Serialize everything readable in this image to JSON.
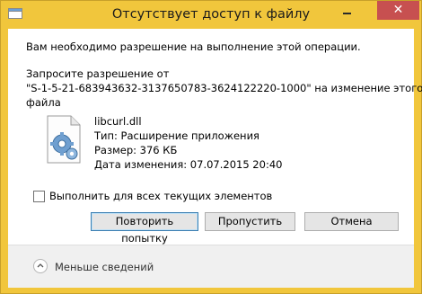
{
  "window": {
    "title": "Отсутствует доступ к файлу",
    "close_label": "✕"
  },
  "dialog": {
    "message": "Вам необходимо разрешение на выполнение этой операции.",
    "request_line1": "Запросите разрешение от",
    "request_line2": "\"S-1-5-21-683943632-3137650783-3624122220-1000\" на изменение этого",
    "request_line3": "файла"
  },
  "file": {
    "icon": "gear-file-icon",
    "name": "libcurl.dll",
    "type": "Тип: Расширение приложения",
    "size": "Размер: 376 КБ",
    "modified": "Дата изменения: 07.07.2015 20:40"
  },
  "checkbox": {
    "label": "Выполнить для всех текущих элементов",
    "checked": false
  },
  "buttons": {
    "retry": "Повторить попытку",
    "skip": "Пропустить",
    "cancel": "Отмена"
  },
  "footer": {
    "less_details": "Меньше сведений"
  },
  "colors": {
    "frame": "#f1c63c",
    "close_button": "#c75050"
  }
}
